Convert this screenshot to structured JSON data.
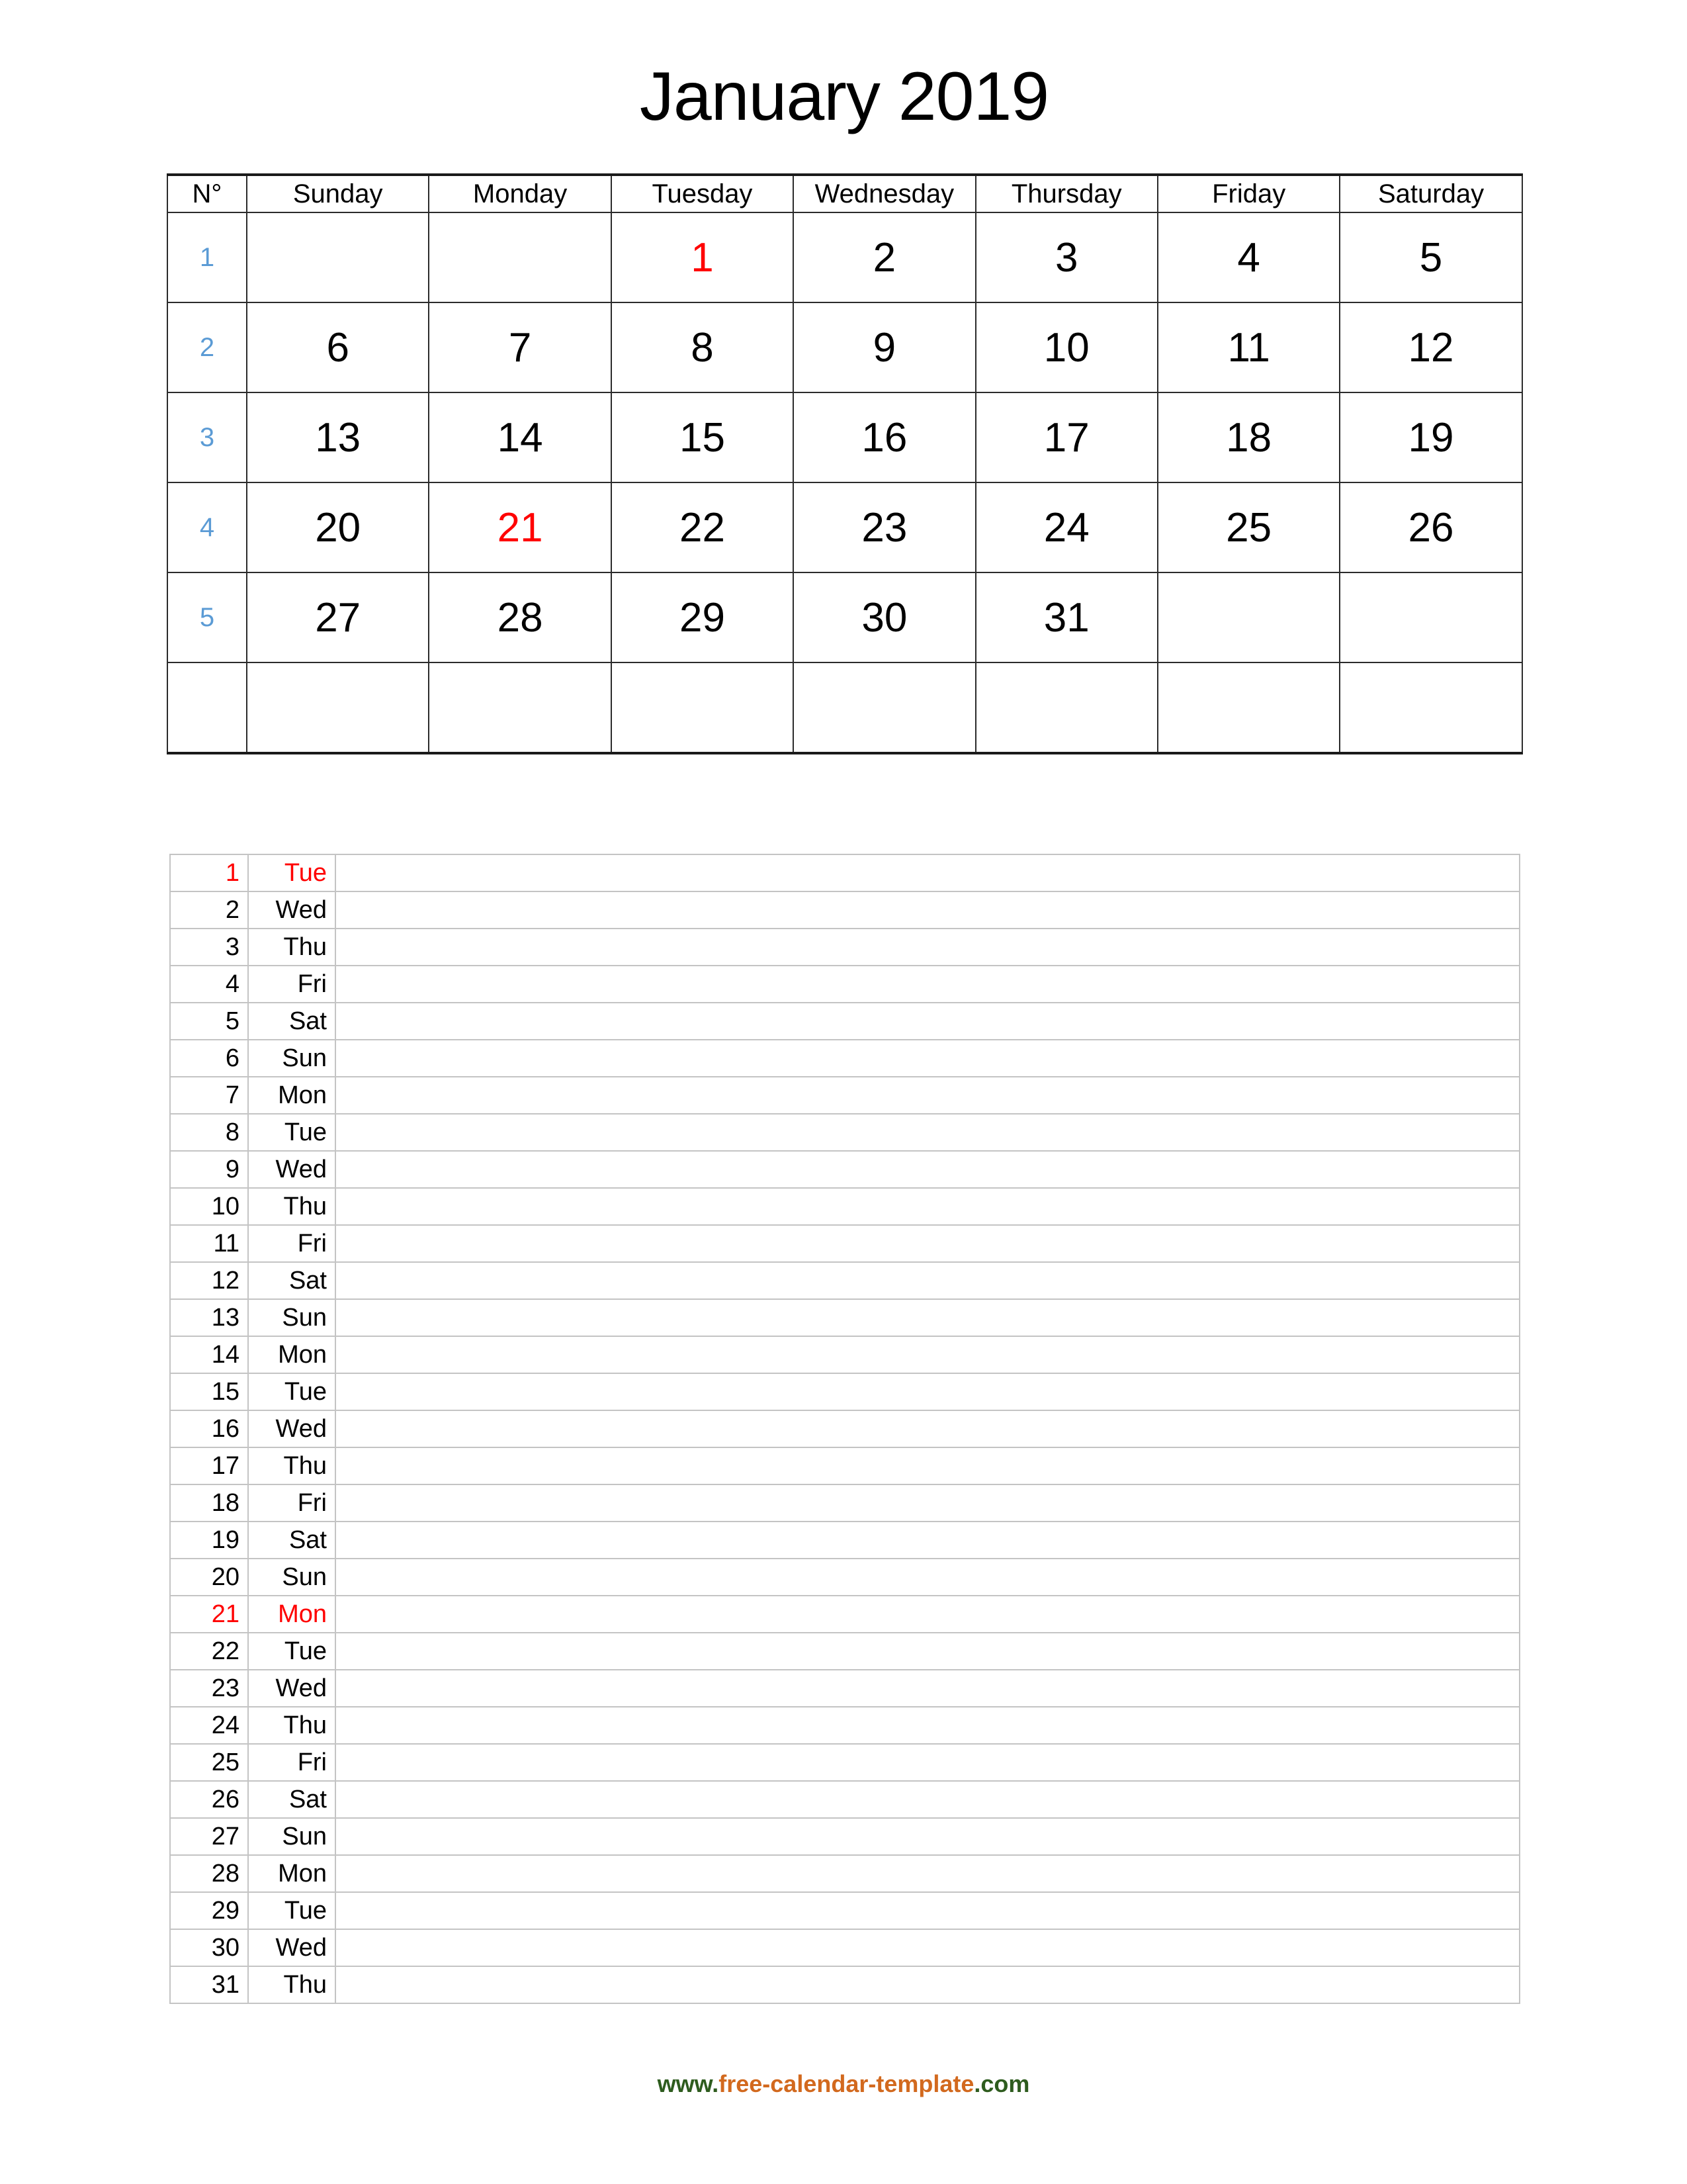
{
  "title": "January 2019",
  "colors": {
    "week_number": "#5b9bd5",
    "holiday": "#ff0000",
    "grid_dark": "#2b2b2b",
    "grid_light": "#c4c4c4",
    "footer_green": "#2e5c1e",
    "footer_orange": "#d2691e"
  },
  "month_grid": {
    "headers": [
      "N°",
      "Sunday",
      "Monday",
      "Tuesday",
      "Wednesday",
      "Thursday",
      "Friday",
      "Saturday"
    ],
    "rows": [
      {
        "week": "1",
        "days": [
          "",
          "",
          "1",
          "2",
          "3",
          "4",
          "5"
        ],
        "holidays": [
          2
        ]
      },
      {
        "week": "2",
        "days": [
          "6",
          "7",
          "8",
          "9",
          "10",
          "11",
          "12"
        ],
        "holidays": []
      },
      {
        "week": "3",
        "days": [
          "13",
          "14",
          "15",
          "16",
          "17",
          "18",
          "19"
        ],
        "holidays": []
      },
      {
        "week": "4",
        "days": [
          "20",
          "21",
          "22",
          "23",
          "24",
          "25",
          "26"
        ],
        "holidays": [
          1
        ]
      },
      {
        "week": "5",
        "days": [
          "27",
          "28",
          "29",
          "30",
          "31",
          "",
          ""
        ],
        "holidays": []
      },
      {
        "week": "",
        "days": [
          "",
          "",
          "",
          "",
          "",
          "",
          ""
        ],
        "holidays": []
      }
    ]
  },
  "day_list": {
    "rows": [
      {
        "num": "1",
        "abbr": "Tue",
        "note": "",
        "holiday": true
      },
      {
        "num": "2",
        "abbr": "Wed",
        "note": "",
        "holiday": false
      },
      {
        "num": "3",
        "abbr": "Thu",
        "note": "",
        "holiday": false
      },
      {
        "num": "4",
        "abbr": "Fri",
        "note": "",
        "holiday": false
      },
      {
        "num": "5",
        "abbr": "Sat",
        "note": "",
        "holiday": false
      },
      {
        "num": "6",
        "abbr": "Sun",
        "note": "",
        "holiday": false
      },
      {
        "num": "7",
        "abbr": "Mon",
        "note": "",
        "holiday": false
      },
      {
        "num": "8",
        "abbr": "Tue",
        "note": "",
        "holiday": false
      },
      {
        "num": "9",
        "abbr": "Wed",
        "note": "",
        "holiday": false
      },
      {
        "num": "10",
        "abbr": "Thu",
        "note": "",
        "holiday": false
      },
      {
        "num": "11",
        "abbr": "Fri",
        "note": "",
        "holiday": false
      },
      {
        "num": "12",
        "abbr": "Sat",
        "note": "",
        "holiday": false
      },
      {
        "num": "13",
        "abbr": "Sun",
        "note": "",
        "holiday": false
      },
      {
        "num": "14",
        "abbr": "Mon",
        "note": "",
        "holiday": false
      },
      {
        "num": "15",
        "abbr": "Tue",
        "note": "",
        "holiday": false
      },
      {
        "num": "16",
        "abbr": "Wed",
        "note": "",
        "holiday": false
      },
      {
        "num": "17",
        "abbr": "Thu",
        "note": "",
        "holiday": false
      },
      {
        "num": "18",
        "abbr": "Fri",
        "note": "",
        "holiday": false
      },
      {
        "num": "19",
        "abbr": "Sat",
        "note": "",
        "holiday": false
      },
      {
        "num": "20",
        "abbr": "Sun",
        "note": "",
        "holiday": false
      },
      {
        "num": "21",
        "abbr": "Mon",
        "note": "",
        "holiday": true
      },
      {
        "num": "22",
        "abbr": "Tue",
        "note": "",
        "holiday": false
      },
      {
        "num": "23",
        "abbr": "Wed",
        "note": "",
        "holiday": false
      },
      {
        "num": "24",
        "abbr": "Thu",
        "note": "",
        "holiday": false
      },
      {
        "num": "25",
        "abbr": "Fri",
        "note": "",
        "holiday": false
      },
      {
        "num": "26",
        "abbr": "Sat",
        "note": "",
        "holiday": false
      },
      {
        "num": "27",
        "abbr": "Sun",
        "note": "",
        "holiday": false
      },
      {
        "num": "28",
        "abbr": "Mon",
        "note": "",
        "holiday": false
      },
      {
        "num": "29",
        "abbr": "Tue",
        "note": "",
        "holiday": false
      },
      {
        "num": "30",
        "abbr": "Wed",
        "note": "",
        "holiday": false
      },
      {
        "num": "31",
        "abbr": "Thu",
        "note": "",
        "holiday": false
      }
    ]
  },
  "footer": {
    "www": "www.",
    "name": "free-calendar-template",
    "tld": ".com"
  }
}
